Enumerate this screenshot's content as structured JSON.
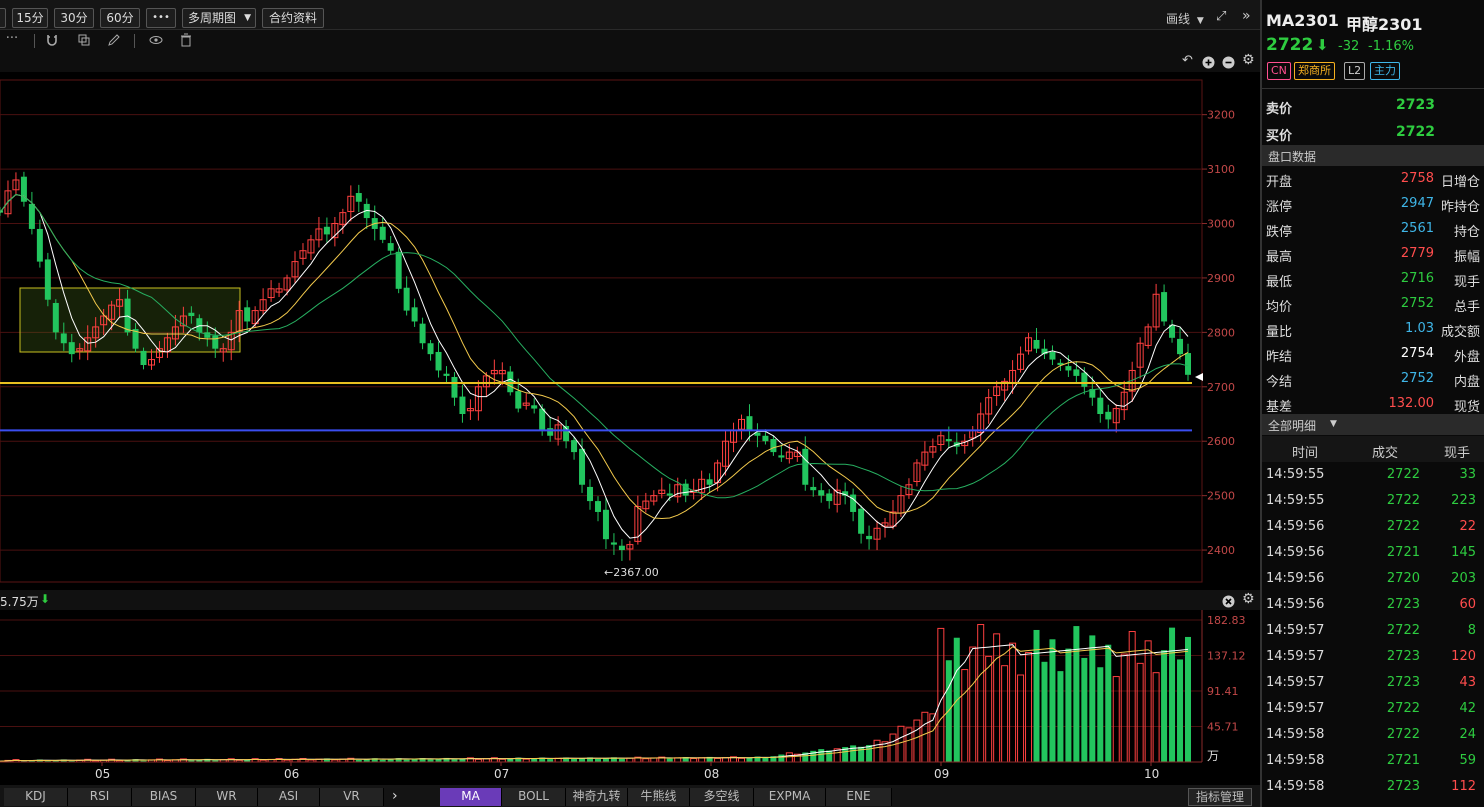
{
  "toolbar": {
    "periods": [
      "15分",
      "30分",
      "60分"
    ],
    "more": "•••",
    "multi_period": "多周期图",
    "contract_info": "合约资料",
    "draw": "画线",
    "ellipsis": "···"
  },
  "chart_data": {
    "type": "candlestick",
    "ylim": [
      2345,
      3260
    ],
    "y_ticks": [
      2400,
      2500,
      2600,
      2700,
      2800,
      2900,
      3000,
      3100,
      3200
    ],
    "x_ticks": [
      "05",
      "06",
      "07",
      "08",
      "09",
      "10"
    ],
    "min_label": "←2367.00",
    "h_lines": [
      {
        "price": 2707,
        "color": "#e8c020"
      },
      {
        "price": 2620,
        "color": "#3a4ef0"
      }
    ],
    "closes": [
      3020,
      3060,
      3080,
      3040,
      2990,
      2930,
      2860,
      2800,
      2780,
      2760,
      2770,
      2790,
      2810,
      2830,
      2850,
      2860,
      2800,
      2770,
      2740,
      2750,
      2770,
      2790,
      2810,
      2830,
      2830,
      2800,
      2790,
      2770,
      2770,
      2800,
      2840,
      2820,
      2840,
      2860,
      2880,
      2880,
      2900,
      2930,
      2950,
      2970,
      2990,
      2980,
      3000,
      3020,
      3050,
      3040,
      3010,
      2990,
      2970,
      2950,
      2880,
      2840,
      2820,
      2780,
      2760,
      2730,
      2720,
      2680,
      2650,
      2660,
      2700,
      2720,
      2730,
      2730,
      2690,
      2660,
      2670,
      2660,
      2620,
      2610,
      2630,
      2600,
      2580,
      2520,
      2490,
      2470,
      2420,
      2410,
      2400,
      2410,
      2480,
      2490,
      2500,
      2510,
      2500,
      2520,
      2500,
      2510,
      2530,
      2520,
      2560,
      2600,
      2620,
      2640,
      2620,
      2610,
      2600,
      2580,
      2570,
      2580,
      2580,
      2520,
      2510,
      2500,
      2490,
      2510,
      2500,
      2470,
      2430,
      2420,
      2440,
      2450,
      2470,
      2500,
      2520,
      2560,
      2580,
      2590,
      2610,
      2600,
      2590,
      2600,
      2620,
      2650,
      2680,
      2700,
      2710,
      2730,
      2760,
      2790,
      2770,
      2760,
      2750,
      2740,
      2730,
      2720,
      2700,
      2680,
      2650,
      2640,
      2660,
      2690,
      2730,
      2780,
      2810,
      2870,
      2820,
      2790,
      2760,
      2722
    ]
  },
  "volume": {
    "label": "5.75万",
    "ticks": [
      182.83,
      137.12,
      91.41,
      45.71
    ],
    "unit": "万",
    "max": 182.83
  },
  "tabs_left": [
    "KDJ",
    "RSI",
    "BIAS",
    "WR",
    "ASI",
    "VR"
  ],
  "tabs_right": [
    "MA",
    "BOLL",
    "神奇九转",
    "牛熊线",
    "多空线",
    "EXPMA",
    "ENE"
  ],
  "tab_active": "MA",
  "indicator_manage": "指标管理",
  "quote": {
    "code": "MA2301",
    "name": "甲醇2301",
    "price": "2722",
    "change": "-32",
    "pct": "-1.16%",
    "badges": [
      "CN",
      "郑商所",
      "L2",
      "主力"
    ],
    "ask_label": "卖价",
    "ask": "2723",
    "bid_label": "买价",
    "bid": "2722",
    "section": "盘口数据",
    "rows": [
      {
        "label": "开盘",
        "value": "2758",
        "color": "#ff4d4d",
        "label2": "日增仓"
      },
      {
        "label": "涨停",
        "value": "2947",
        "color": "#3fb6e8",
        "label2": "昨持仓"
      },
      {
        "label": "跌停",
        "value": "2561",
        "color": "#3fb6e8",
        "label2": "持仓"
      },
      {
        "label": "最高",
        "value": "2779",
        "color": "#ff4d4d",
        "label2": "振幅"
      },
      {
        "label": "最低",
        "value": "2716",
        "color": "#2ecc40",
        "label2": "现手"
      },
      {
        "label": "均价",
        "value": "2752",
        "color": "#2ecc40",
        "label2": "总手"
      },
      {
        "label": "量比",
        "value": "1.03",
        "color": "#3fb6e8",
        "label2": "成交额"
      },
      {
        "label": "昨结",
        "value": "2754",
        "color": "#ffffff",
        "label2": "外盘"
      },
      {
        "label": "今结",
        "value": "2752",
        "color": "#3fb6e8",
        "label2": "内盘"
      },
      {
        "label": "基差",
        "value": "132.00",
        "color": "#ff4d4d",
        "label2": "现货"
      }
    ],
    "detail_title": "全部明细",
    "detail_headers": [
      "时间",
      "成交",
      "现手"
    ],
    "ticks": [
      {
        "time": "14:59:55",
        "price": "2722",
        "pc": "#2ecc40",
        "vol": "33",
        "vc": "#2ecc40"
      },
      {
        "time": "14:59:55",
        "price": "2722",
        "pc": "#2ecc40",
        "vol": "223",
        "vc": "#2ecc40"
      },
      {
        "time": "14:59:56",
        "price": "2722",
        "pc": "#2ecc40",
        "vol": "22",
        "vc": "#ff4d4d"
      },
      {
        "time": "14:59:56",
        "price": "2721",
        "pc": "#2ecc40",
        "vol": "145",
        "vc": "#2ecc40"
      },
      {
        "time": "14:59:56",
        "price": "2720",
        "pc": "#2ecc40",
        "vol": "203",
        "vc": "#2ecc40"
      },
      {
        "time": "14:59:56",
        "price": "2723",
        "pc": "#2ecc40",
        "vol": "60",
        "vc": "#ff4d4d"
      },
      {
        "time": "14:59:57",
        "price": "2722",
        "pc": "#2ecc40",
        "vol": "8",
        "vc": "#2ecc40"
      },
      {
        "time": "14:59:57",
        "price": "2723",
        "pc": "#2ecc40",
        "vol": "120",
        "vc": "#ff4d4d"
      },
      {
        "time": "14:59:57",
        "price": "2723",
        "pc": "#2ecc40",
        "vol": "43",
        "vc": "#ff4d4d"
      },
      {
        "time": "14:59:57",
        "price": "2722",
        "pc": "#2ecc40",
        "vol": "42",
        "vc": "#2ecc40"
      },
      {
        "time": "14:59:58",
        "price": "2722",
        "pc": "#2ecc40",
        "vol": "24",
        "vc": "#2ecc40"
      },
      {
        "time": "14:59:58",
        "price": "2721",
        "pc": "#2ecc40",
        "vol": "59",
        "vc": "#2ecc40"
      },
      {
        "time": "14:59:58",
        "price": "2723",
        "pc": "#2ecc40",
        "vol": "112",
        "vc": "#ff4d4d"
      }
    ]
  }
}
